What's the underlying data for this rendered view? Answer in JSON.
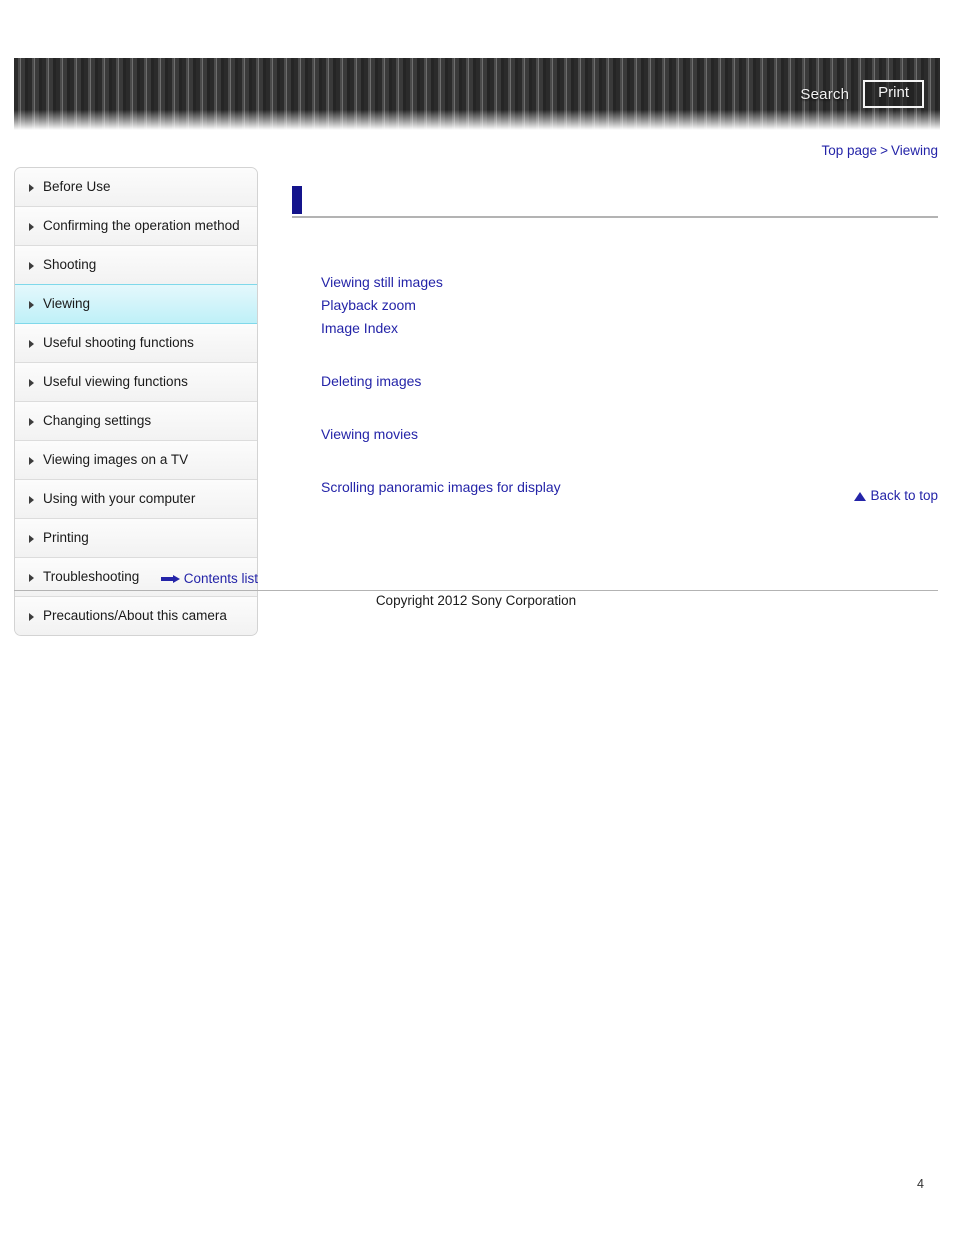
{
  "header": {
    "search_label": "Search",
    "print_label": "Print",
    "search_icon": "search-icon",
    "print_icon": "print-icon"
  },
  "breadcrumb": {
    "items": [
      "Top page",
      "Viewing"
    ],
    "separator": ">"
  },
  "sidebar": {
    "items": [
      {
        "label": "Before Use",
        "active": false
      },
      {
        "label": "Confirming the operation method",
        "active": false
      },
      {
        "label": "Shooting",
        "active": false
      },
      {
        "label": "Viewing",
        "active": true
      },
      {
        "label": "Useful shooting functions",
        "active": false
      },
      {
        "label": "Useful viewing functions",
        "active": false
      },
      {
        "label": "Changing settings",
        "active": false
      },
      {
        "label": "Viewing images on a TV",
        "active": false
      },
      {
        "label": "Using with your computer",
        "active": false
      },
      {
        "label": "Printing",
        "active": false
      },
      {
        "label": "Troubleshooting",
        "active": false
      },
      {
        "label": "Precautions/About this camera",
        "active": false
      }
    ],
    "contents_list_label": "Contents list",
    "contents_list_icon": "arrow-right-icon"
  },
  "main": {
    "heading": "",
    "link_groups": [
      {
        "links": [
          "Viewing still images",
          "Playback zoom",
          "Image Index"
        ]
      },
      {
        "links": [
          "Deleting images"
        ]
      },
      {
        "links": [
          "Viewing movies"
        ]
      },
      {
        "links": [
          "Scrolling panoramic images for display"
        ]
      }
    ],
    "back_to_top_label": "Back to top",
    "back_to_top_icon": "triangle-up-icon"
  },
  "footer": {
    "copyright": "Copyright 2012 Sony Corporation",
    "page_number": "4"
  },
  "colors": {
    "link": "#2424a8",
    "heading_marker": "#14148c",
    "active_nav": "#bff0f8",
    "active_nav_border": "#7fd8ea",
    "header_dark": "#2b2b2b"
  }
}
